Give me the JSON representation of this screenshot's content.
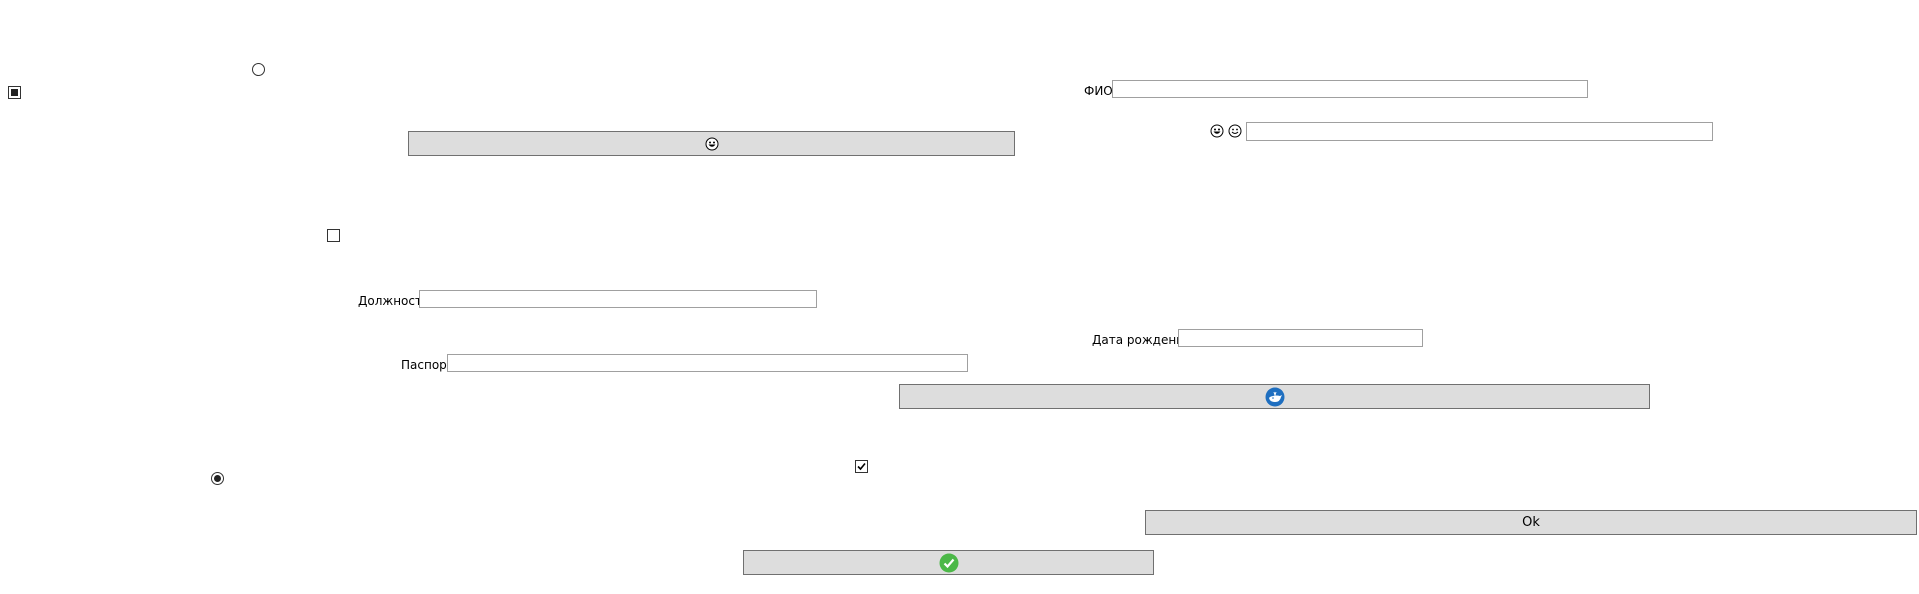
{
  "form": {
    "fio_label": "ФИО",
    "fio_value": "",
    "dolzhnost_label": "Должность",
    "dolzhnost_value": "",
    "data_rozhdeniya_label": "Дата рождения",
    "data_rozhdeniya_value": "",
    "pasport_label": "Паспорт",
    "pasport_value": "",
    "emoji_field_value": ""
  },
  "buttons": {
    "ok_label": "Ok",
    "emoji_button_icon": "grinning-face-icon",
    "whale_button_icon": "whale-icon",
    "check_button_icon": "check-circle-icon"
  },
  "checkboxes": {
    "indeterminate_state": "indeterminate",
    "empty_state": "unchecked",
    "checked_state": "checked"
  },
  "radios": {
    "top_state": "unselected",
    "bottom_state": "selected"
  },
  "icons": {
    "emoji_field_icons": [
      "grinning-face-icon",
      "smiley-face-icon"
    ]
  },
  "colors": {
    "button_bg": "#dddddd",
    "whale_blue": "#1f6fc0",
    "check_green": "#4cb848"
  }
}
